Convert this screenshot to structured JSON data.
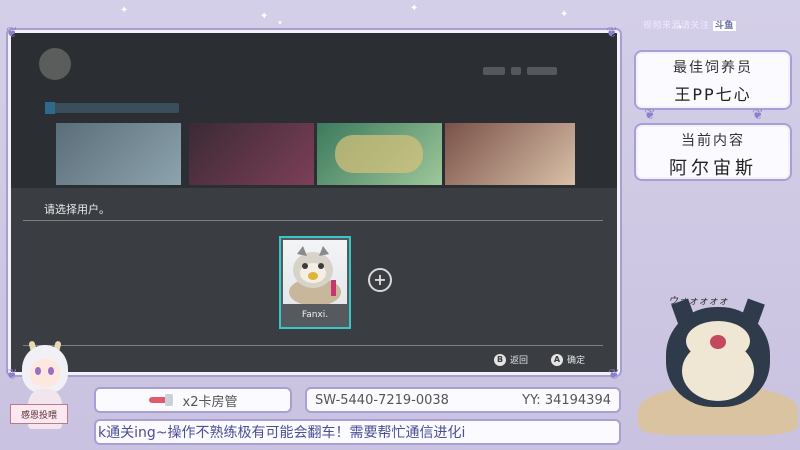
{
  "overlay": {
    "watermark": "视频来源请关注",
    "watermark_logo": "斗鱼",
    "panel_top": {
      "heading": "最佳饲养员",
      "value": "王PP七心"
    },
    "panel_mid": {
      "heading": "当前内容",
      "value": "阿尔宙斯"
    },
    "gift_line": "x2卡房管",
    "switch_code": "SW-5440-7219-0038",
    "yy": "YY:  34194394",
    "ticker": "k通关ing~操作不熟练极有可能会翻车！需要帮忙通信进化i",
    "sign": "感恩投喂",
    "sfx": "ウォォォォォ"
  },
  "game": {
    "dialog_title": "请选择用户。",
    "user_name": "Fanxi.",
    "add_label": "+",
    "hint_back_btn": "B",
    "hint_back_label": "返回",
    "hint_ok_btn": "A",
    "hint_ok_label": "确定"
  },
  "colors": {
    "accent_cyan": "#36c7c8",
    "frame_lavender": "#a99fd4",
    "dialog_bg": "#3a3d42"
  }
}
